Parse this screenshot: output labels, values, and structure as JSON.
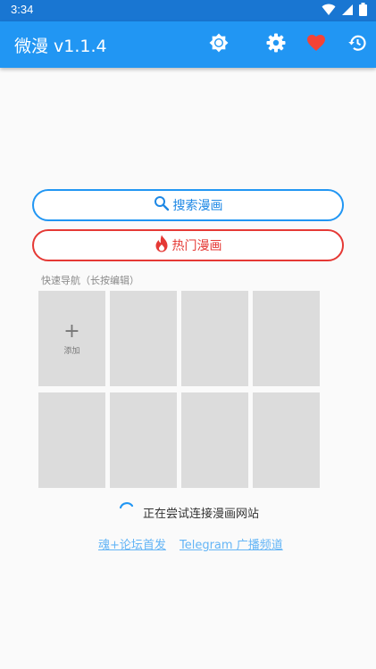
{
  "status_bar": {
    "time": "3:34",
    "icons": [
      "wifi-icon",
      "signal-icon",
      "battery-icon"
    ]
  },
  "app_bar": {
    "title": "微漫 v1.1.4",
    "actions": [
      "brightness-icon",
      "settings-icon",
      "favorite-icon",
      "history-icon"
    ],
    "favorite_color": "#f44336"
  },
  "search_button": {
    "label": "搜索漫画",
    "icon": "search-icon",
    "color": "#2196f3"
  },
  "hot_button": {
    "label": "热门漫画",
    "icon": "fire-icon",
    "color": "#e53935"
  },
  "quick_nav": {
    "title": "快速导航（长按编辑）",
    "add_label": "添加",
    "add_symbol": "+",
    "empty_tile_count": 7
  },
  "loading": {
    "text": "正在尝试连接漫画网站"
  },
  "links": {
    "forum": "魂+论坛首发",
    "telegram": "Telegram 广播频道"
  },
  "colors": {
    "primary": "#2196f3",
    "status_bar": "#1976d2",
    "tile": "#dcdcdc",
    "link": "#64b5f6"
  }
}
